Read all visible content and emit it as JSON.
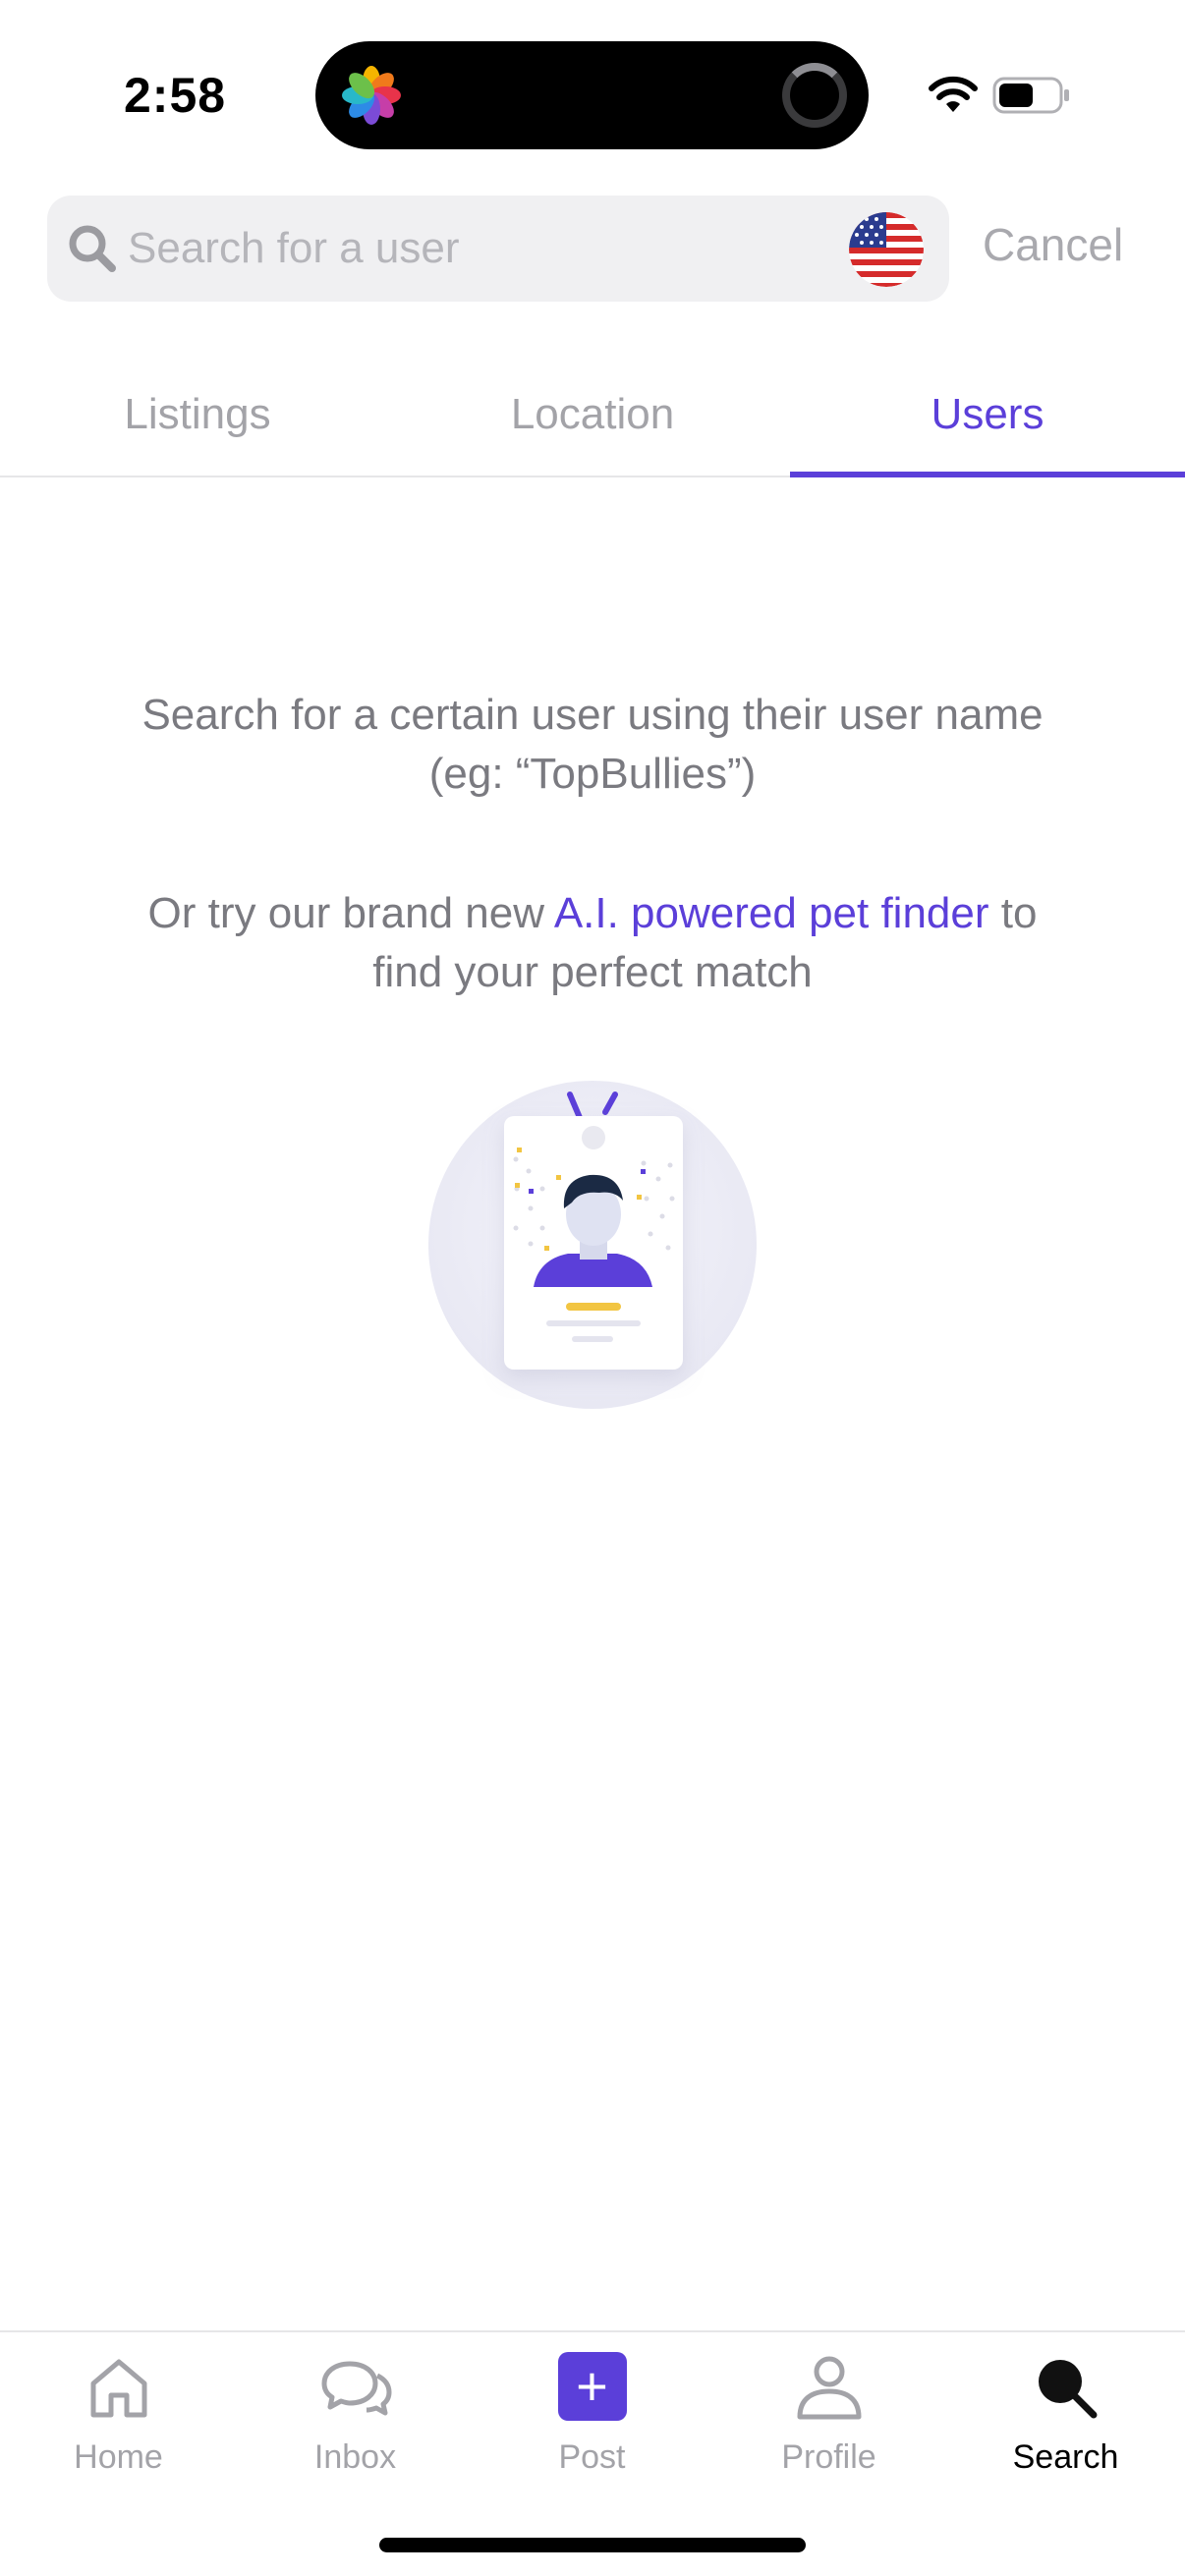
{
  "status_bar": {
    "time": "2:58"
  },
  "search": {
    "placeholder": "Search for a user",
    "cancel_label": "Cancel",
    "region_icon": "us-flag-icon"
  },
  "tabs": [
    {
      "label": "Listings",
      "active": false
    },
    {
      "label": "Location",
      "active": false
    },
    {
      "label": "Users",
      "active": true
    }
  ],
  "main": {
    "hint_line_1": "Search for a certain user using their user name",
    "hint_line_2": "(eg: “TopBullies”)",
    "try_prefix": "Or try our brand new",
    "try_link": "A.I. powered pet finder",
    "try_suffix_line_1": "to",
    "try_suffix_line_2": "find your perfect match",
    "illustration_icon": "user-id-card-icon"
  },
  "bottom_nav": [
    {
      "label": "Home",
      "icon": "home-icon",
      "active": false
    },
    {
      "label": "Inbox",
      "icon": "chat-bubbles-icon",
      "active": false
    },
    {
      "label": "Post",
      "icon": "plus-icon",
      "active": false
    },
    {
      "label": "Profile",
      "icon": "person-icon",
      "active": false
    },
    {
      "label": "Search",
      "icon": "search-icon",
      "active": true
    }
  ],
  "colors": {
    "accent": "#5b3fd9",
    "muted": "#a3a3a8",
    "text": "#7a7a80",
    "search_bg": "#f0f0f2"
  }
}
